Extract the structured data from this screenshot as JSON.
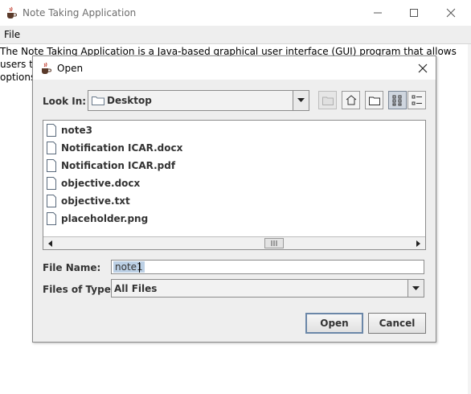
{
  "window": {
    "title": "Note Taking Application",
    "icon": "java-coffee-icon"
  },
  "menubar": {
    "file": "File"
  },
  "document": {
    "lines": [
      "The Note Taking Application is a Java-based graphical user interface (GUI) program that allows",
      "users to",
      " options"
    ]
  },
  "dialog": {
    "title": "Open",
    "look_in_label": "Look In:",
    "look_in_value": "Desktop",
    "toolbar_icons": [
      "up-one-level-icon",
      "home-icon",
      "new-folder-icon",
      "list-view-icon",
      "details-view-icon"
    ],
    "files": [
      "note3",
      "Notification ICAR.docx",
      "Notification ICAR.pdf",
      "objective.docx",
      "objective.txt",
      "placeholder.png"
    ],
    "file_name_label": "File Name:",
    "file_name_value": "note1",
    "file_type_label": "Files of Type:",
    "file_type_value": "All Files",
    "open_button": "Open",
    "cancel_button": "Cancel"
  },
  "colors": {
    "dialog_bg": "#eeeeee",
    "selection": "#bcd0e5",
    "default_button_border": "#6b87a8"
  }
}
